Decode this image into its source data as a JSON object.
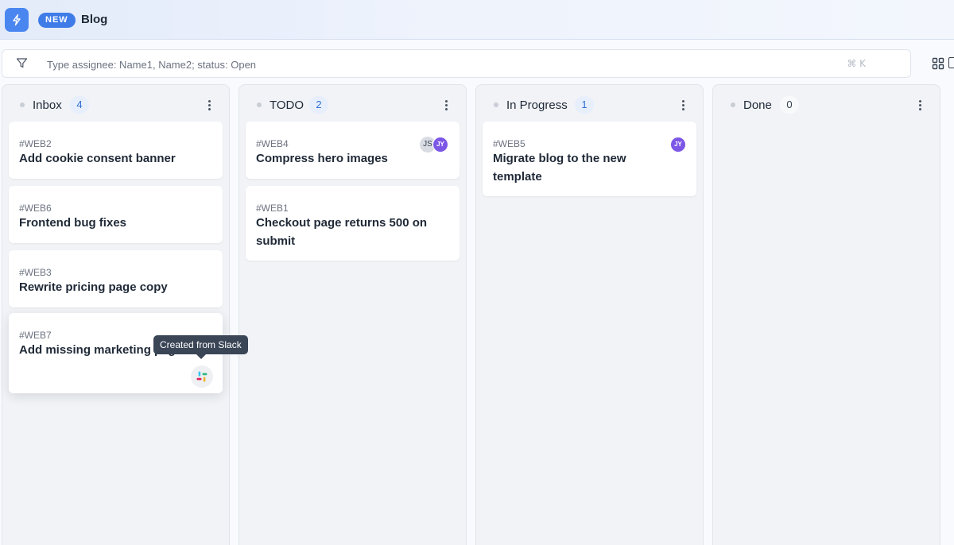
{
  "header": {
    "badge": "NEW",
    "title": "Blog",
    "app_icon": "lightning-icon",
    "brand_color": "#4a86f0"
  },
  "filter": {
    "placeholder": "Type assignee: Name1, Name2; status: Open",
    "shortcut": "⌘ K",
    "icon": "filter-icon"
  },
  "view_toggle": {
    "icon": "grid-view-icon"
  },
  "columns": [
    {
      "title": "Inbox",
      "count": "4",
      "cards": [
        {
          "id": "#WEB2",
          "title": "Add cookie consent banner"
        },
        {
          "id": "#WEB6",
          "title": "Frontend bug fixes"
        },
        {
          "id": "#WEB3",
          "title": "Rewrite pricing page copy"
        },
        {
          "id": "#WEB7",
          "title": "Add missing marketing pages",
          "source_icon": "slack-icon"
        }
      ]
    },
    {
      "title": "TODO",
      "count": "2",
      "cards": [
        {
          "id": "#WEB4",
          "title": "Compress hero images",
          "assignees": [
            "JS",
            "JY"
          ]
        },
        {
          "id": "#WEB1",
          "title": "Checkout page returns 500 on submit"
        }
      ]
    },
    {
      "title": "In Progress",
      "count": "1",
      "cards": [
        {
          "id": "#WEB5",
          "title": "Migrate blog to the new template",
          "assignees": [
            "JY"
          ]
        }
      ]
    },
    {
      "title": "Done",
      "count": "0",
      "cards": []
    }
  ],
  "tooltip": {
    "text": "Created from Slack"
  },
  "colors": {
    "accent": "#3f7ce8",
    "count_badge_bg": "#e8effc",
    "avatar_jy": "#7c57e6",
    "tooltip_bg": "#3a4556"
  }
}
